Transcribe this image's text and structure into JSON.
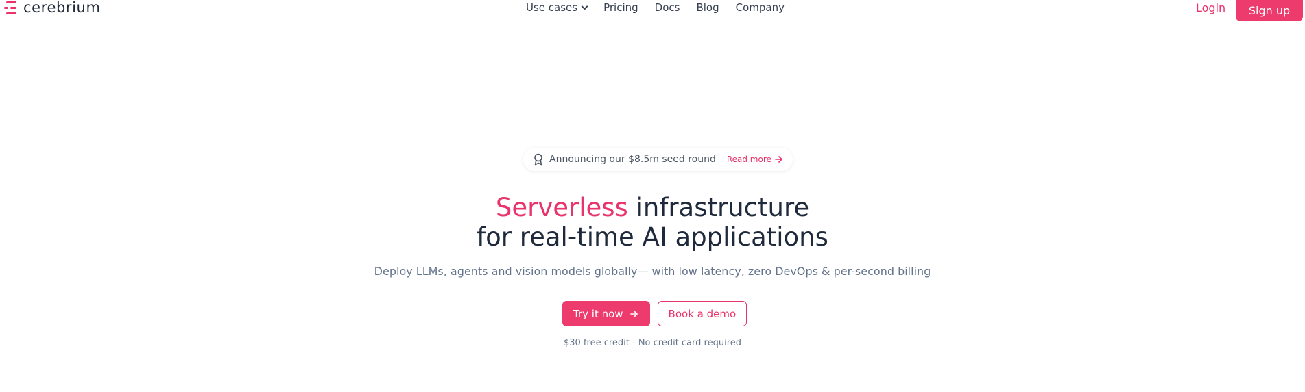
{
  "brand": {
    "name": "cerebrium",
    "accent": "#e8336b"
  },
  "nav": {
    "items": [
      {
        "label": "Use cases",
        "has_dropdown": true
      },
      {
        "label": "Pricing"
      },
      {
        "label": "Docs"
      },
      {
        "label": "Blog"
      },
      {
        "label": "Company"
      }
    ]
  },
  "auth": {
    "login": "Login",
    "signup": "Sign up"
  },
  "announcement": {
    "icon": "award-icon",
    "text": "Announcing our $8.5m seed round",
    "link": "Read more"
  },
  "hero": {
    "title_accent": "Serverless",
    "title_rest": " infrastructure",
    "title_line2": "for real-time AI applications",
    "subtitle": "Deploy LLMs, agents and vision models globally— with low latency, zero DevOps & per-second billing"
  },
  "cta": {
    "primary": "Try it now",
    "secondary": "Book a demo"
  },
  "credit_note": "$30 free credit - No credit card required"
}
